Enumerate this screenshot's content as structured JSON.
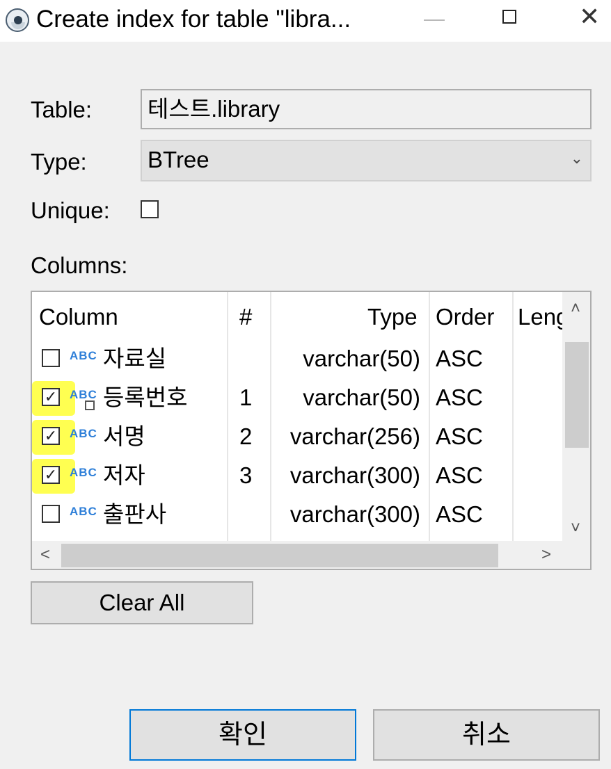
{
  "window": {
    "title": "Create index for table \"libra...",
    "icon": "dbeaver-logo-icon"
  },
  "form": {
    "table_label": "Table:",
    "table_value": "테스트.library",
    "type_label": "Type:",
    "type_value": "BTree",
    "unique_label": "Unique:",
    "unique_checked": false,
    "columns_label": "Columns:"
  },
  "columns_table": {
    "headers": {
      "column": "Column",
      "num": "#",
      "type": "Type",
      "order": "Order",
      "length": "Leng"
    },
    "rows": [
      {
        "checked": false,
        "checkmark": "",
        "icon": "ABC",
        "name": "자료실",
        "num": "",
        "type": "varchar(50)",
        "order": "ASC",
        "highlighted": false,
        "key_badge": false
      },
      {
        "checked": true,
        "checkmark": "✓",
        "icon": "ABC",
        "name": "등록번호",
        "num": "1",
        "type": "varchar(50)",
        "order": "ASC",
        "highlighted": true,
        "key_badge": true
      },
      {
        "checked": true,
        "checkmark": "✓",
        "icon": "ABC",
        "name": "서명",
        "num": "2",
        "type": "varchar(256)",
        "order": "ASC",
        "highlighted": true,
        "key_badge": false
      },
      {
        "checked": true,
        "checkmark": "✓",
        "icon": "ABC",
        "name": "저자",
        "num": "3",
        "type": "varchar(300)",
        "order": "ASC",
        "highlighted": true,
        "key_badge": false
      },
      {
        "checked": false,
        "checkmark": "",
        "icon": "ABC",
        "name": "출판사",
        "num": "",
        "type": "varchar(300)",
        "order": "ASC",
        "highlighted": false,
        "key_badge": false
      }
    ],
    "scroll_up": "˄",
    "scroll_down": "˅",
    "scroll_left": "<",
    "scroll_right": ">"
  },
  "buttons": {
    "clear_all": "Clear All",
    "ok": "확인",
    "cancel": "취소"
  },
  "colors": {
    "highlight": "#ffff33",
    "abc_icon": "#2e7fd8",
    "ok_border": "#0078d7"
  }
}
